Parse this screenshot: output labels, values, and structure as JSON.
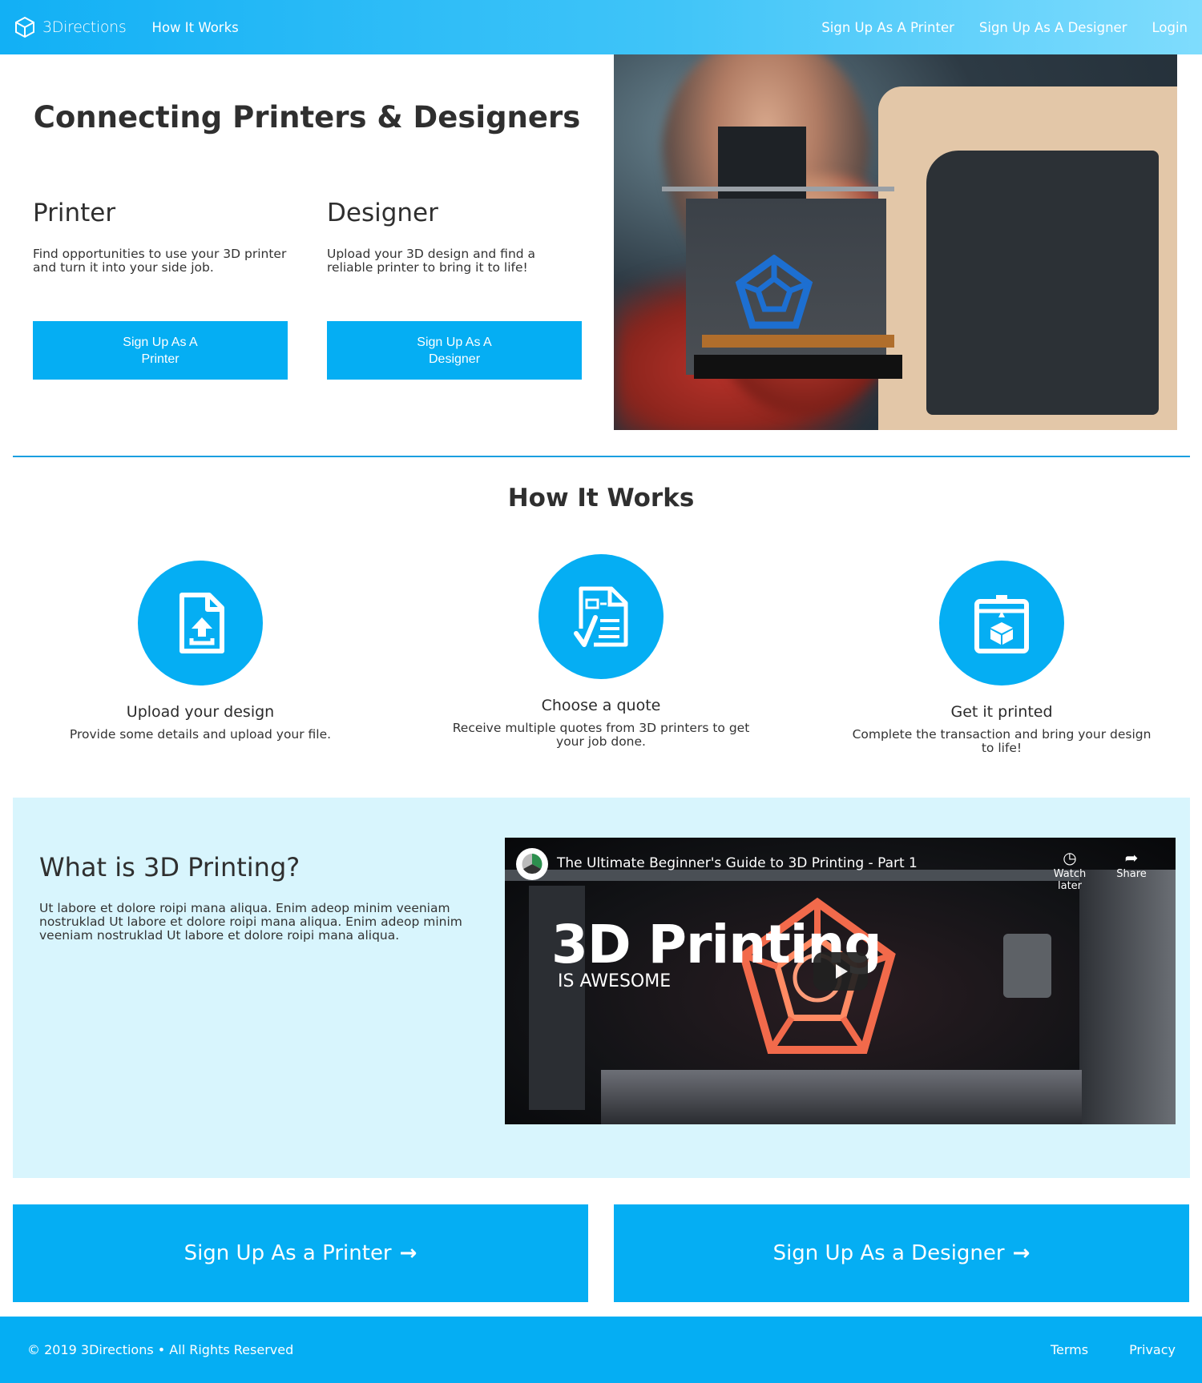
{
  "nav": {
    "brand": "3Directions",
    "how_it_works": "How It Works",
    "signup_printer": "Sign Up As A Printer",
    "signup_designer": "Sign Up As A Designer",
    "login": "Login"
  },
  "hero": {
    "title": "Connecting Printers & Designers",
    "printer": {
      "heading": "Printer",
      "text": "Find opportunities to use your 3D printer and turn it into your side job.",
      "button": "Sign Up As A Printer"
    },
    "designer": {
      "heading": "Designer",
      "text": "Upload your 3D design and find a reliable printer to bring it to life!",
      "button": "Sign Up As A Designer"
    }
  },
  "how": {
    "title": "How It Works",
    "steps": [
      {
        "icon": "upload-file-icon",
        "title": "Upload your design",
        "text": "Provide some details and upload your file."
      },
      {
        "icon": "quote-document-icon",
        "title": "Choose a quote",
        "text": "Receive multiple quotes from 3D printers to get your job done."
      },
      {
        "icon": "3d-printer-icon",
        "title": "Get it printed",
        "text": "Complete the transaction and bring your design to life!"
      }
    ]
  },
  "what": {
    "title": "What is 3D Printing?",
    "text": "Ut labore et dolore roipi mana aliqua. Enim adeop minim veeniam nostruklad Ut labore et dolore roipi mana aliqua. Enim adeop minim veeniam nostruklad Ut labore et dolore roipi mana aliqua.",
    "video": {
      "title": "The Ultimate Beginner's Guide to 3D Printing - Part 1",
      "watch_later": "Watch later",
      "share": "Share",
      "big_text": "3D Printing",
      "small_text": "IS AWESOME"
    }
  },
  "cta": {
    "printer": "Sign Up As a Printer",
    "designer": "Sign Up As a Designer",
    "arrow": "→"
  },
  "footer": {
    "copyright": "© 2019 3Directions • All Rights Reserved",
    "terms": "Terms",
    "privacy": "Privacy"
  },
  "colors": {
    "primary": "#05aef3",
    "light_section": "#d8f5fd",
    "divider": "#1a9fe0"
  }
}
